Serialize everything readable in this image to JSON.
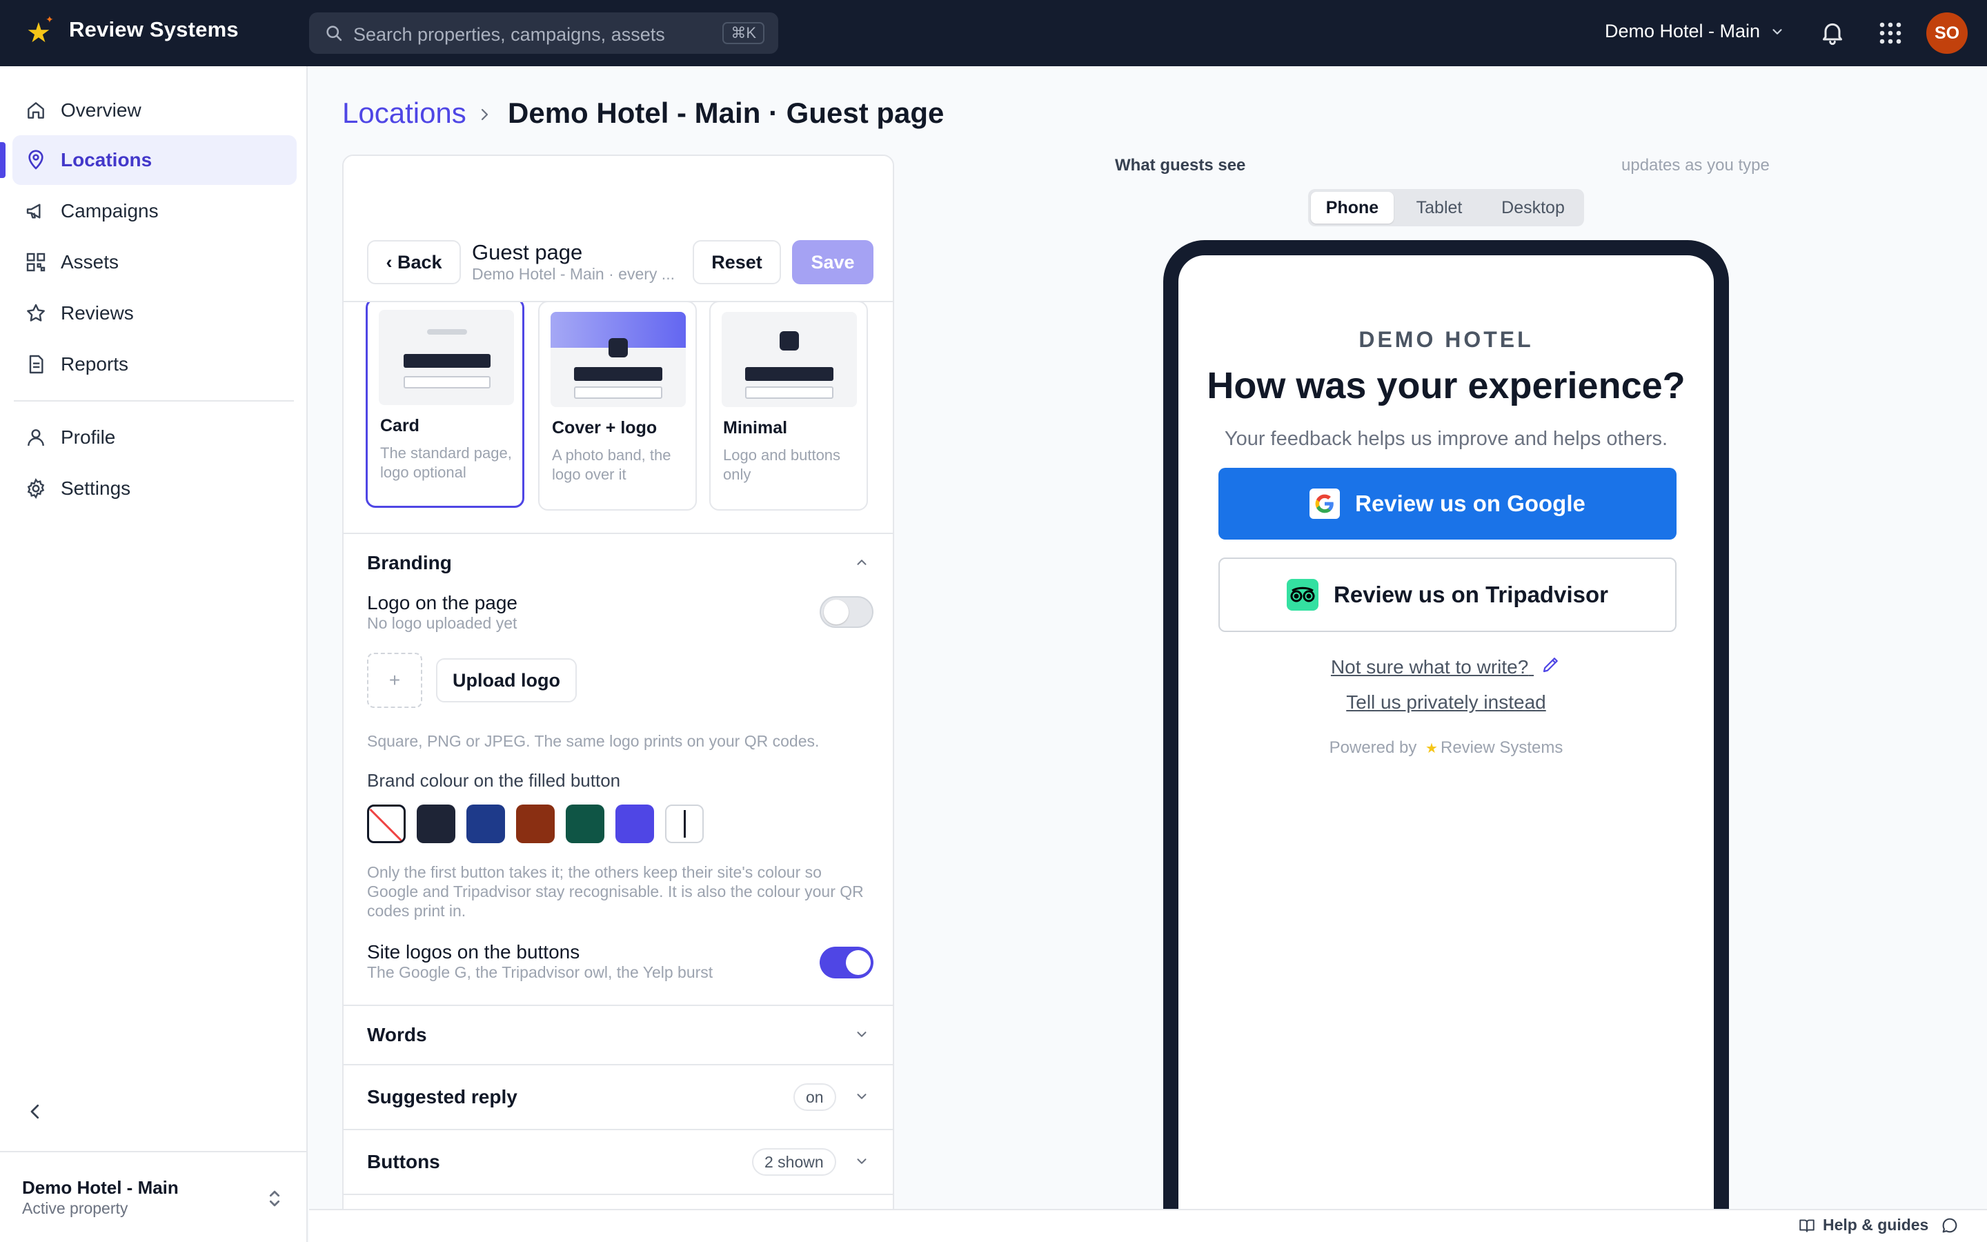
{
  "app": {
    "name": "Review Systems",
    "avatar_initials": "SO",
    "accent": "#4f46e5"
  },
  "search": {
    "placeholder": "Search properties, campaigns, assets",
    "shortcut": "⌘K"
  },
  "property_switcher": {
    "label": "Demo Hotel - Main"
  },
  "sidebar": {
    "items": [
      {
        "label": "Overview",
        "icon": "home-icon"
      },
      {
        "label": "Locations",
        "icon": "map-pin-icon",
        "active": true
      },
      {
        "label": "Campaigns",
        "icon": "megaphone-icon"
      },
      {
        "label": "Assets",
        "icon": "qr-code-icon"
      },
      {
        "label": "Reviews",
        "icon": "star-icon"
      },
      {
        "label": "Reports",
        "icon": "document-icon"
      }
    ],
    "secondary": [
      {
        "label": "Profile",
        "icon": "user-icon"
      },
      {
        "label": "Settings",
        "icon": "gear-icon"
      }
    ],
    "footer": {
      "name": "Demo Hotel - Main",
      "status": "Active property"
    }
  },
  "breadcrumb": {
    "parent": "Locations",
    "current": "Demo Hotel - Main · Guest page"
  },
  "editor": {
    "back_label": "‹ Back",
    "title": "Guest page",
    "subtitle": "Demo Hotel - Main · every ...",
    "reset_label": "Reset",
    "save_label": "Save",
    "layouts": [
      {
        "title": "Card",
        "desc": "The standard page, logo optional",
        "selected": true
      },
      {
        "title": "Cover + logo",
        "desc": "A photo band, the logo over it"
      },
      {
        "title": "Minimal",
        "desc": "Logo and buttons only"
      }
    ],
    "branding": {
      "title": "Branding",
      "logo_title": "Logo on the page",
      "logo_sub": "No logo uploaded yet",
      "logo_enabled": false,
      "drop_symbol": "+",
      "upload_label": "Upload logo",
      "logo_hint": "Square, PNG or JPEG. The same logo prints on your QR codes.",
      "colour_title": "Brand colour on the filled button",
      "swatches": [
        "none",
        "#1e2436",
        "#1e3a8a",
        "#8a2f12",
        "#0f5545",
        "#4f46e5",
        "custom"
      ],
      "colour_hint": "Only the first button takes it; the others keep their site's colour so Google and Tripadvisor stay recognisable. It is also the colour your QR codes print in.",
      "site_logos_title": "Site logos on the buttons",
      "site_logos_sub": "The Google G, the Tripadvisor owl, the Yelp burst",
      "site_logos_enabled": true
    },
    "sections": [
      {
        "title": "Words",
        "badge": ""
      },
      {
        "title": "Suggested reply",
        "badge": "on"
      },
      {
        "title": "Buttons",
        "badge": "2 shown"
      }
    ]
  },
  "preview": {
    "label": "What guests see",
    "note": "updates as you type",
    "devices": [
      "Phone",
      "Tablet",
      "Desktop"
    ],
    "active_device": "Phone",
    "hotel": "DEMO HOTEL",
    "headline": "How was your experience?",
    "subline": "Your feedback helps us improve and helps others.",
    "google_btn": "Review us on Google",
    "google_color": "#1a73e8",
    "tripadvisor_btn": "Review us on Tripadvisor",
    "help_link": "Not sure what to write?",
    "private_link": "Tell us privately instead",
    "powered_by": "Powered by",
    "powered_brand": "Review Systems"
  },
  "footer": {
    "help_label": "Help & guides"
  }
}
